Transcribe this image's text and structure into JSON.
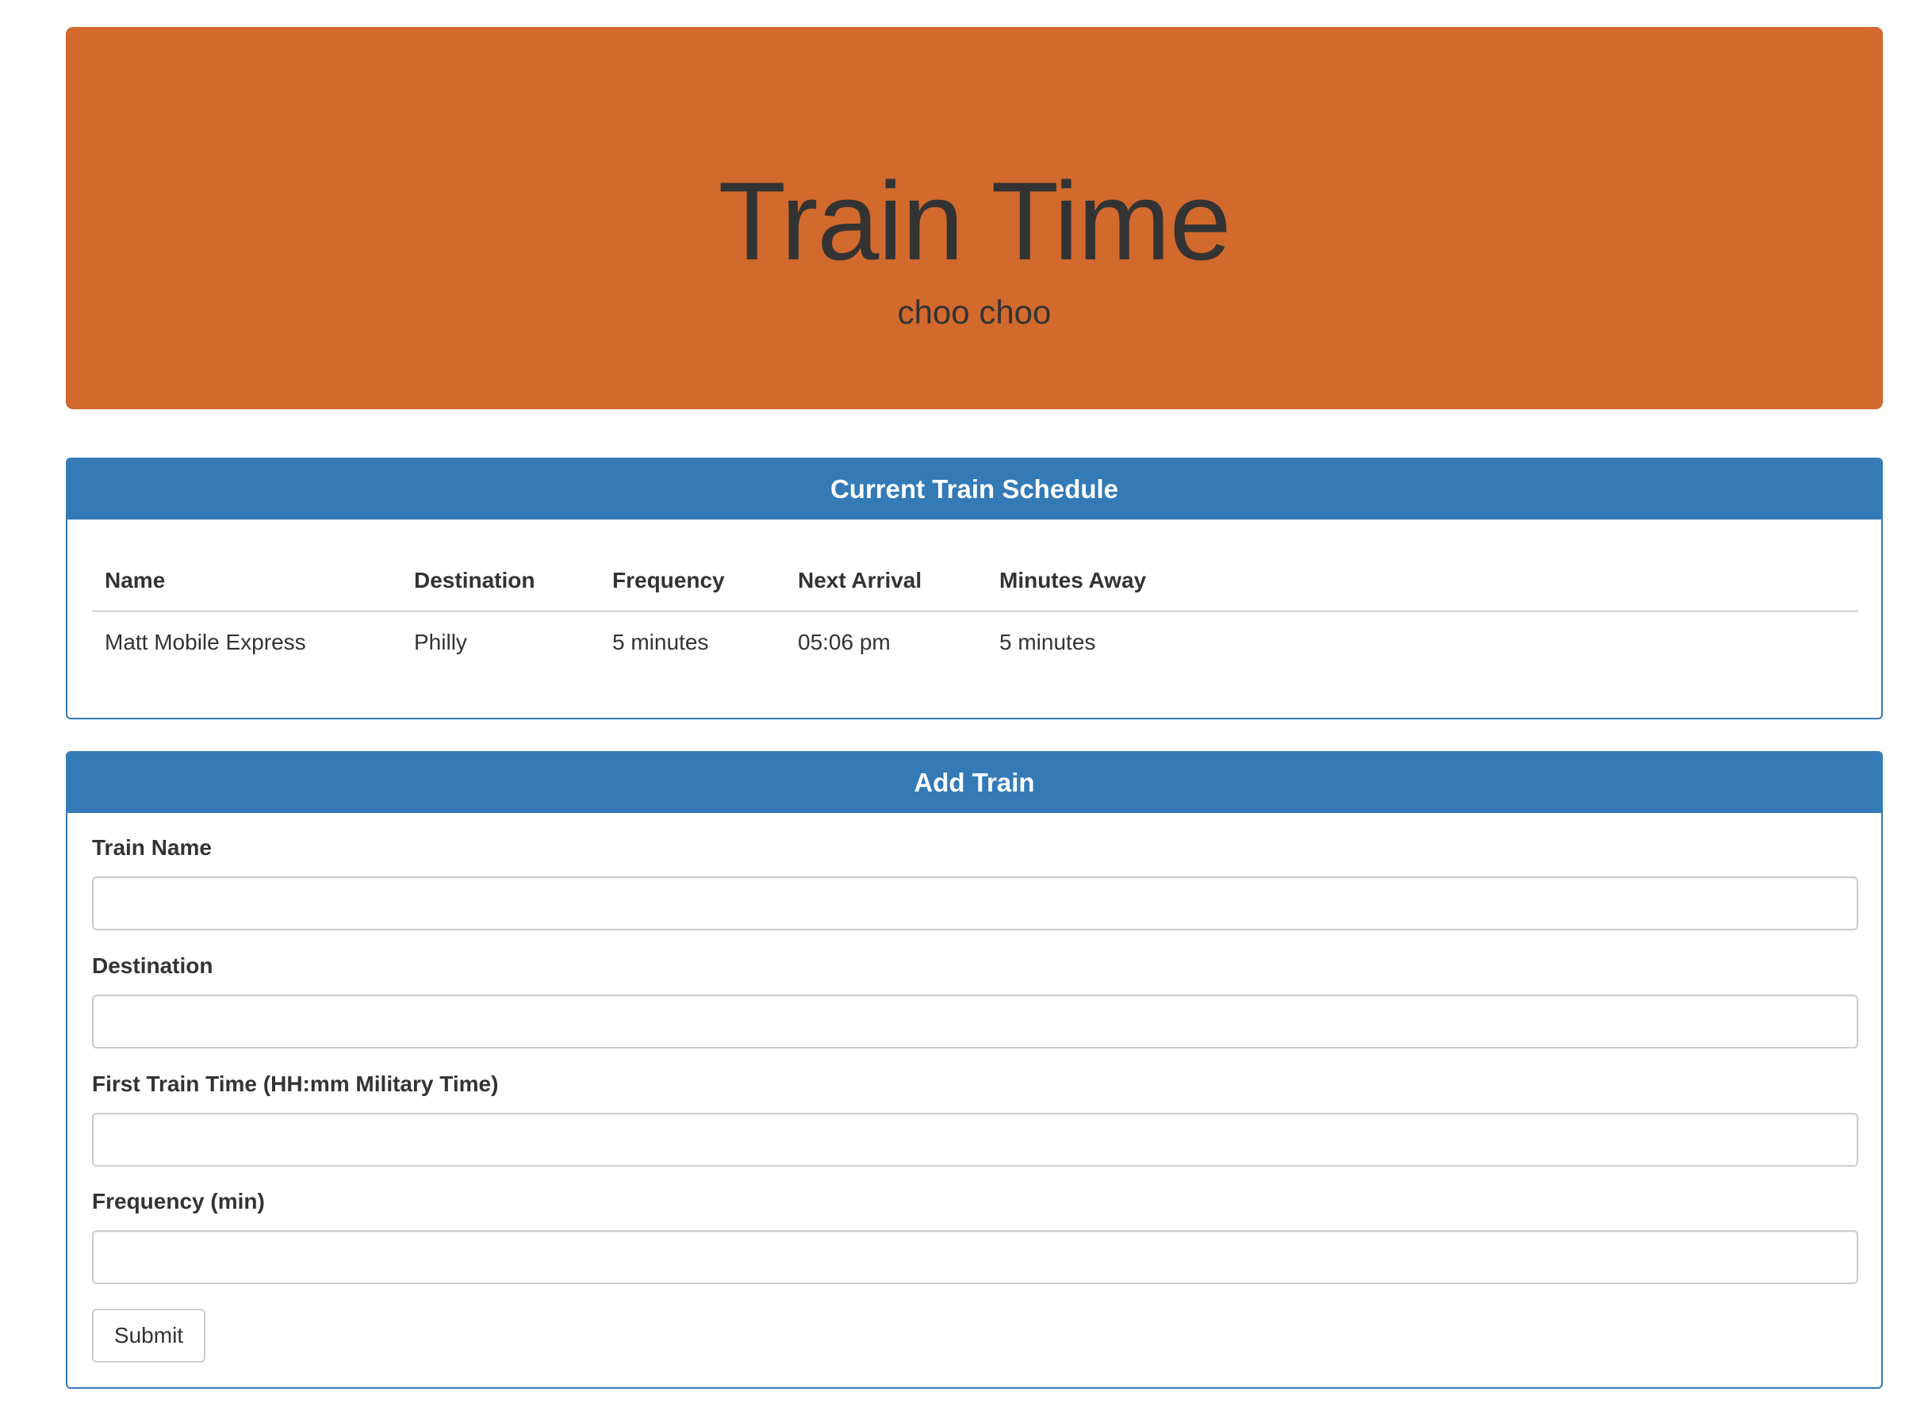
{
  "header": {
    "title": "Train Time",
    "subtitle": "choo choo"
  },
  "schedule": {
    "heading": "Current Train Schedule",
    "columns": [
      "Name",
      "Destination",
      "Frequency",
      "Next Arrival",
      "Minutes Away"
    ],
    "rows": [
      [
        "Matt Mobile Express",
        "Philly",
        "5 minutes",
        "05:06 pm",
        "5 minutes"
      ]
    ]
  },
  "add_train": {
    "heading": "Add Train",
    "fields": {
      "train_name": {
        "label": "Train Name",
        "value": "",
        "placeholder": ""
      },
      "destination": {
        "label": "Destination",
        "value": "",
        "placeholder": ""
      },
      "first_time": {
        "label": "First Train Time (HH:mm Military Time)",
        "value": "",
        "placeholder": ""
      },
      "frequency": {
        "label": "Frequency (min)",
        "value": "",
        "placeholder": ""
      }
    },
    "submit_label": "Submit"
  },
  "colors": {
    "jumbotron": "#d2692d",
    "panel_primary": "#337ab7",
    "text": "#333333"
  }
}
